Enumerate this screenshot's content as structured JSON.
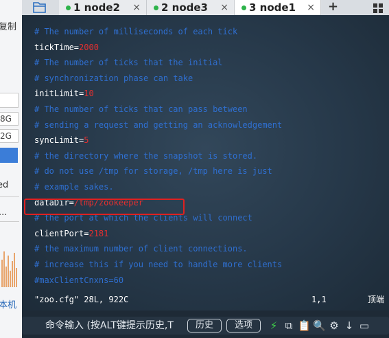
{
  "background_app": {
    "copy_text": "复制",
    "field_1": "8G",
    "field_2": "2G",
    "text_ed": "ed",
    "text_dots": "...",
    "machine_text": "本机"
  },
  "tabs": [
    {
      "label": "1 node2",
      "close": "×"
    },
    {
      "label": "2 node3",
      "close": "×"
    },
    {
      "label": "3 node1",
      "close": "×",
      "active": true
    }
  ],
  "new_tab_symbol": "+",
  "editor": {
    "lines": [
      {
        "comment": "# The number of milliseconds of each tick"
      },
      {
        "key": "tickTime=",
        "value": "2000"
      },
      {
        "comment": "# The number of ticks that the initial"
      },
      {
        "comment": "# synchronization phase can take"
      },
      {
        "key": "initLimit=",
        "value": "10"
      },
      {
        "comment": "# The number of ticks that can pass between"
      },
      {
        "comment": "# sending a request and getting an acknowledgement"
      },
      {
        "key": "syncLimit=",
        "value": "5"
      },
      {
        "comment": "# the directory where the snapshot is stored."
      },
      {
        "comment": "# do not use /tmp for storage, /tmp here is just"
      },
      {
        "comment": "# example sakes."
      },
      {
        "key": "dataDir=",
        "value": "/tmp/zookeeper"
      },
      {
        "comment": "# the port at which the clients will connect"
      },
      {
        "key": "clientPort=",
        "value": "2181"
      },
      {
        "comment": "# the maximum number of client connections."
      },
      {
        "comment": "# increase this if you need to handle more clients"
      },
      {
        "comment": "#maxClientCnxns=60"
      }
    ],
    "status": {
      "file": "\"zoo.cfg\" 28L, 922C",
      "position": "1,1",
      "scroll": "顶端"
    }
  },
  "command_bar": {
    "placeholder": "命令输入 (按ALT键提示历史,T",
    "history_button": "历史",
    "options_button": "选项"
  },
  "colors": {
    "comment": "#2f6fd0",
    "key": "#ffffff",
    "value": "#e53030",
    "highlight_border": "#e02020",
    "tab_dot": "#2db34a"
  }
}
